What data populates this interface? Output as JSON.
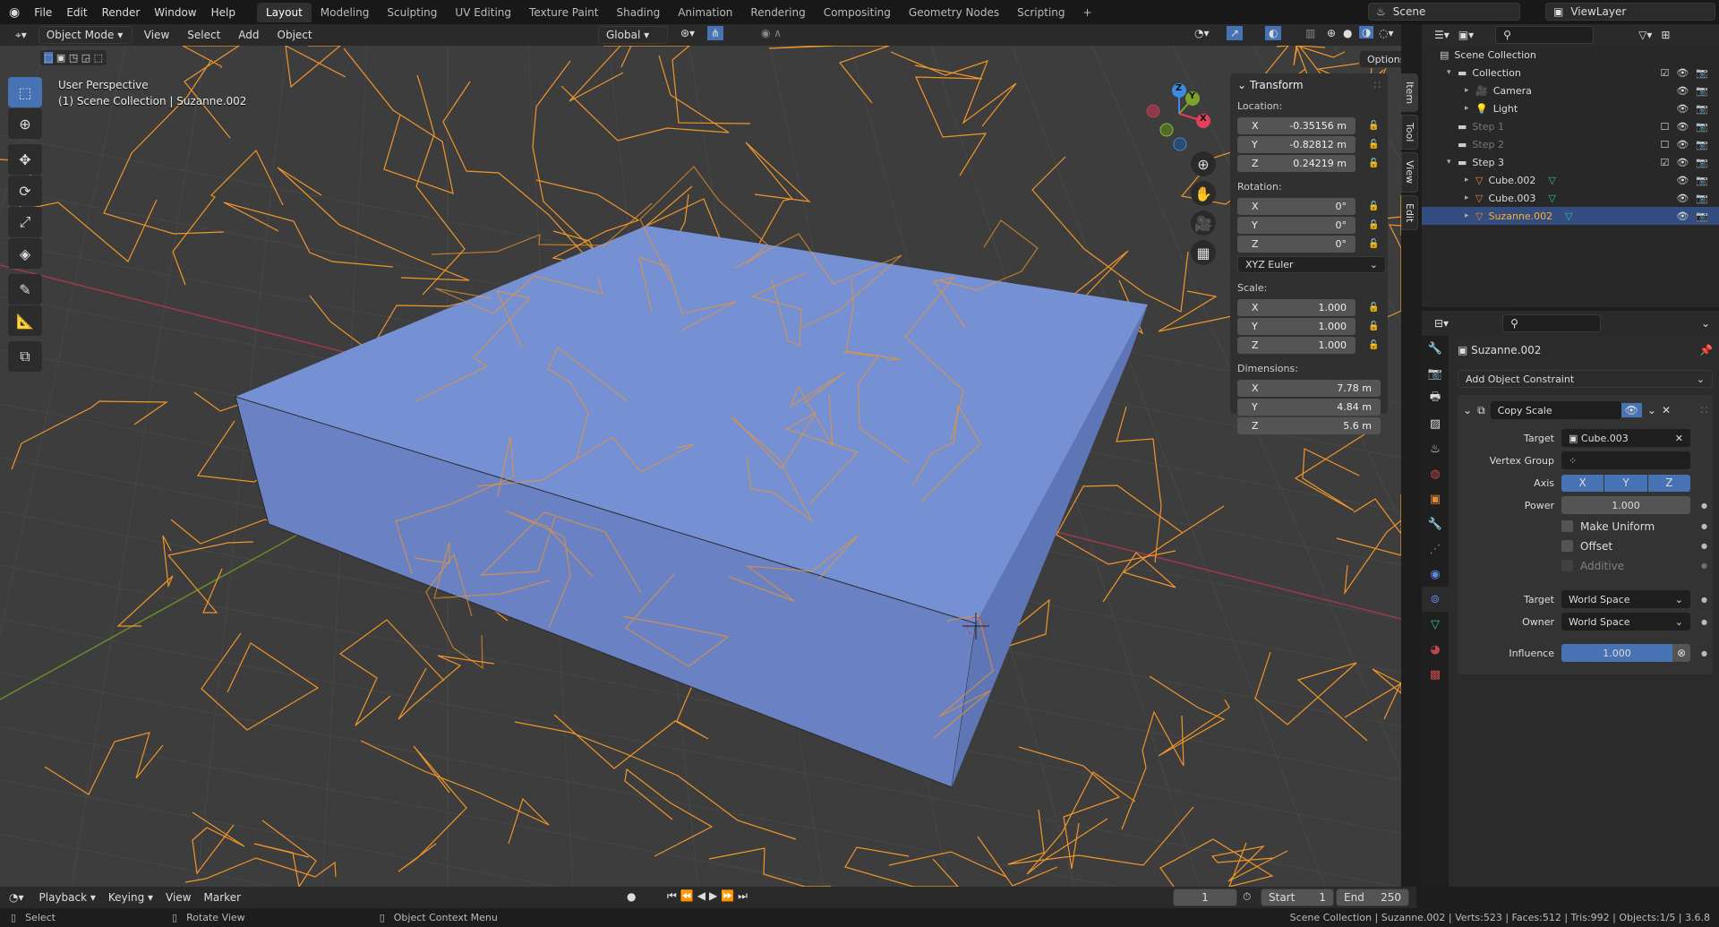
{
  "topbar": {
    "menus": [
      "File",
      "Edit",
      "Render",
      "Window",
      "Help"
    ],
    "workspaces": [
      "Layout",
      "Modeling",
      "Sculpting",
      "UV Editing",
      "Texture Paint",
      "Shading",
      "Animation",
      "Rendering",
      "Compositing",
      "Geometry Nodes",
      "Scripting"
    ],
    "active_workspace": "Layout",
    "add_tab": "+",
    "scene": "Scene",
    "view_layer": "ViewLayer"
  },
  "viewport_header": {
    "mode": "Object Mode",
    "menus": [
      "View",
      "Select",
      "Add",
      "Object"
    ],
    "orientation": "Global",
    "options": "Options"
  },
  "viewport": {
    "perspective": "User Perspective",
    "context": "(1) Scene Collection | Suzanne.002",
    "gizmo": {
      "x": "X",
      "y": "Y",
      "z": "Z"
    },
    "colors": {
      "background": "#3d3d3d",
      "box": "#7088c8",
      "wire": "#f0952a",
      "x_axis": "#9c3a4a",
      "y_axis": "#6a8c2a"
    }
  },
  "npanel": {
    "title": "Transform",
    "location_label": "Location:",
    "location": [
      {
        "axis": "X",
        "value": "-0.35156 m"
      },
      {
        "axis": "Y",
        "value": "-0.82812 m"
      },
      {
        "axis": "Z",
        "value": "0.24219 m"
      }
    ],
    "rotation_label": "Rotation:",
    "rotation": [
      {
        "axis": "X",
        "value": "0°"
      },
      {
        "axis": "Y",
        "value": "0°"
      },
      {
        "axis": "Z",
        "value": "0°"
      }
    ],
    "rotation_mode": "XYZ Euler",
    "scale_label": "Scale:",
    "scale": [
      {
        "axis": "X",
        "value": "1.000"
      },
      {
        "axis": "Y",
        "value": "1.000"
      },
      {
        "axis": "Z",
        "value": "1.000"
      }
    ],
    "dimensions_label": "Dimensions:",
    "dimensions": [
      {
        "axis": "X",
        "value": "7.78 m"
      },
      {
        "axis": "Y",
        "value": "4.84 m"
      },
      {
        "axis": "Z",
        "value": "5.6 m"
      }
    ],
    "tabs": [
      "Item",
      "Tool",
      "View",
      "Edit"
    ]
  },
  "outliner": {
    "rows": [
      {
        "label": "Scene Collection",
        "indent": 0,
        "type": "scene"
      },
      {
        "label": "Collection",
        "indent": 1,
        "type": "collection",
        "checked": true
      },
      {
        "label": "Camera",
        "indent": 2,
        "type": "camera"
      },
      {
        "label": "Light",
        "indent": 2,
        "type": "light"
      },
      {
        "label": "Step 1",
        "indent": 1,
        "type": "collection",
        "checked": false,
        "dim": true
      },
      {
        "label": "Step 2",
        "indent": 1,
        "type": "collection",
        "checked": false,
        "dim": true
      },
      {
        "label": "Step 3",
        "indent": 1,
        "type": "collection",
        "checked": true
      },
      {
        "label": "Cube.002",
        "indent": 2,
        "type": "mesh"
      },
      {
        "label": "Cube.003",
        "indent": 2,
        "type": "mesh"
      },
      {
        "label": "Suzanne.002",
        "indent": 2,
        "type": "mesh",
        "selected": true
      }
    ]
  },
  "properties": {
    "object": "Suzanne.002",
    "add_constraint": "Add Object Constraint",
    "constraint_name": "Copy Scale",
    "target_label": "Target",
    "target": "Cube.003",
    "vertex_group_label": "Vertex Group",
    "vertex_group": "",
    "axis_label": "Axis",
    "axes": [
      "X",
      "Y",
      "Z"
    ],
    "power_label": "Power",
    "power": "1.000",
    "make_uniform": "Make Uniform",
    "offset": "Offset",
    "additive": "Additive",
    "target_space_label": "Target",
    "target_space": "World Space",
    "owner_space_label": "Owner",
    "owner_space": "World Space",
    "influence_label": "Influence",
    "influence": "1.000"
  },
  "timeline": {
    "menus": [
      "Playback",
      "Keying",
      "View",
      "Marker"
    ],
    "current_frame": "1",
    "start_label": "Start",
    "start": "1",
    "end_label": "End",
    "end": "250"
  },
  "status": {
    "select": "Select",
    "rotate": "Rotate View",
    "context_menu": "Object Context Menu",
    "stats": "Scene Collection | Suzanne.002 | Verts:523 | Faces:512 | Tris:992 | Objects:1/5 | 3.6.8"
  }
}
